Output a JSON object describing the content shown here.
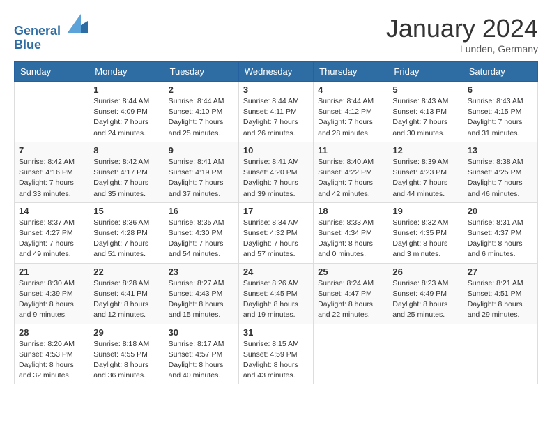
{
  "header": {
    "logo_line1": "General",
    "logo_line2": "Blue",
    "month_title": "January 2024",
    "location": "Lunden, Germany"
  },
  "weekdays": [
    "Sunday",
    "Monday",
    "Tuesday",
    "Wednesday",
    "Thursday",
    "Friday",
    "Saturday"
  ],
  "weeks": [
    [
      {
        "day": "",
        "sunrise": "",
        "sunset": "",
        "daylight": ""
      },
      {
        "day": "1",
        "sunrise": "Sunrise: 8:44 AM",
        "sunset": "Sunset: 4:09 PM",
        "daylight": "Daylight: 7 hours and 24 minutes."
      },
      {
        "day": "2",
        "sunrise": "Sunrise: 8:44 AM",
        "sunset": "Sunset: 4:10 PM",
        "daylight": "Daylight: 7 hours and 25 minutes."
      },
      {
        "day": "3",
        "sunrise": "Sunrise: 8:44 AM",
        "sunset": "Sunset: 4:11 PM",
        "daylight": "Daylight: 7 hours and 26 minutes."
      },
      {
        "day": "4",
        "sunrise": "Sunrise: 8:44 AM",
        "sunset": "Sunset: 4:12 PM",
        "daylight": "Daylight: 7 hours and 28 minutes."
      },
      {
        "day": "5",
        "sunrise": "Sunrise: 8:43 AM",
        "sunset": "Sunset: 4:13 PM",
        "daylight": "Daylight: 7 hours and 30 minutes."
      },
      {
        "day": "6",
        "sunrise": "Sunrise: 8:43 AM",
        "sunset": "Sunset: 4:15 PM",
        "daylight": "Daylight: 7 hours and 31 minutes."
      }
    ],
    [
      {
        "day": "7",
        "sunrise": "Sunrise: 8:42 AM",
        "sunset": "Sunset: 4:16 PM",
        "daylight": "Daylight: 7 hours and 33 minutes."
      },
      {
        "day": "8",
        "sunrise": "Sunrise: 8:42 AM",
        "sunset": "Sunset: 4:17 PM",
        "daylight": "Daylight: 7 hours and 35 minutes."
      },
      {
        "day": "9",
        "sunrise": "Sunrise: 8:41 AM",
        "sunset": "Sunset: 4:19 PM",
        "daylight": "Daylight: 7 hours and 37 minutes."
      },
      {
        "day": "10",
        "sunrise": "Sunrise: 8:41 AM",
        "sunset": "Sunset: 4:20 PM",
        "daylight": "Daylight: 7 hours and 39 minutes."
      },
      {
        "day": "11",
        "sunrise": "Sunrise: 8:40 AM",
        "sunset": "Sunset: 4:22 PM",
        "daylight": "Daylight: 7 hours and 42 minutes."
      },
      {
        "day": "12",
        "sunrise": "Sunrise: 8:39 AM",
        "sunset": "Sunset: 4:23 PM",
        "daylight": "Daylight: 7 hours and 44 minutes."
      },
      {
        "day": "13",
        "sunrise": "Sunrise: 8:38 AM",
        "sunset": "Sunset: 4:25 PM",
        "daylight": "Daylight: 7 hours and 46 minutes."
      }
    ],
    [
      {
        "day": "14",
        "sunrise": "Sunrise: 8:37 AM",
        "sunset": "Sunset: 4:27 PM",
        "daylight": "Daylight: 7 hours and 49 minutes."
      },
      {
        "day": "15",
        "sunrise": "Sunrise: 8:36 AM",
        "sunset": "Sunset: 4:28 PM",
        "daylight": "Daylight: 7 hours and 51 minutes."
      },
      {
        "day": "16",
        "sunrise": "Sunrise: 8:35 AM",
        "sunset": "Sunset: 4:30 PM",
        "daylight": "Daylight: 7 hours and 54 minutes."
      },
      {
        "day": "17",
        "sunrise": "Sunrise: 8:34 AM",
        "sunset": "Sunset: 4:32 PM",
        "daylight": "Daylight: 7 hours and 57 minutes."
      },
      {
        "day": "18",
        "sunrise": "Sunrise: 8:33 AM",
        "sunset": "Sunset: 4:34 PM",
        "daylight": "Daylight: 8 hours and 0 minutes."
      },
      {
        "day": "19",
        "sunrise": "Sunrise: 8:32 AM",
        "sunset": "Sunset: 4:35 PM",
        "daylight": "Daylight: 8 hours and 3 minutes."
      },
      {
        "day": "20",
        "sunrise": "Sunrise: 8:31 AM",
        "sunset": "Sunset: 4:37 PM",
        "daylight": "Daylight: 8 hours and 6 minutes."
      }
    ],
    [
      {
        "day": "21",
        "sunrise": "Sunrise: 8:30 AM",
        "sunset": "Sunset: 4:39 PM",
        "daylight": "Daylight: 8 hours and 9 minutes."
      },
      {
        "day": "22",
        "sunrise": "Sunrise: 8:28 AM",
        "sunset": "Sunset: 4:41 PM",
        "daylight": "Daylight: 8 hours and 12 minutes."
      },
      {
        "day": "23",
        "sunrise": "Sunrise: 8:27 AM",
        "sunset": "Sunset: 4:43 PM",
        "daylight": "Daylight: 8 hours and 15 minutes."
      },
      {
        "day": "24",
        "sunrise": "Sunrise: 8:26 AM",
        "sunset": "Sunset: 4:45 PM",
        "daylight": "Daylight: 8 hours and 19 minutes."
      },
      {
        "day": "25",
        "sunrise": "Sunrise: 8:24 AM",
        "sunset": "Sunset: 4:47 PM",
        "daylight": "Daylight: 8 hours and 22 minutes."
      },
      {
        "day": "26",
        "sunrise": "Sunrise: 8:23 AM",
        "sunset": "Sunset: 4:49 PM",
        "daylight": "Daylight: 8 hours and 25 minutes."
      },
      {
        "day": "27",
        "sunrise": "Sunrise: 8:21 AM",
        "sunset": "Sunset: 4:51 PM",
        "daylight": "Daylight: 8 hours and 29 minutes."
      }
    ],
    [
      {
        "day": "28",
        "sunrise": "Sunrise: 8:20 AM",
        "sunset": "Sunset: 4:53 PM",
        "daylight": "Daylight: 8 hours and 32 minutes."
      },
      {
        "day": "29",
        "sunrise": "Sunrise: 8:18 AM",
        "sunset": "Sunset: 4:55 PM",
        "daylight": "Daylight: 8 hours and 36 minutes."
      },
      {
        "day": "30",
        "sunrise": "Sunrise: 8:17 AM",
        "sunset": "Sunset: 4:57 PM",
        "daylight": "Daylight: 8 hours and 40 minutes."
      },
      {
        "day": "31",
        "sunrise": "Sunrise: 8:15 AM",
        "sunset": "Sunset: 4:59 PM",
        "daylight": "Daylight: 8 hours and 43 minutes."
      },
      {
        "day": "",
        "sunrise": "",
        "sunset": "",
        "daylight": ""
      },
      {
        "day": "",
        "sunrise": "",
        "sunset": "",
        "daylight": ""
      },
      {
        "day": "",
        "sunrise": "",
        "sunset": "",
        "daylight": ""
      }
    ]
  ]
}
